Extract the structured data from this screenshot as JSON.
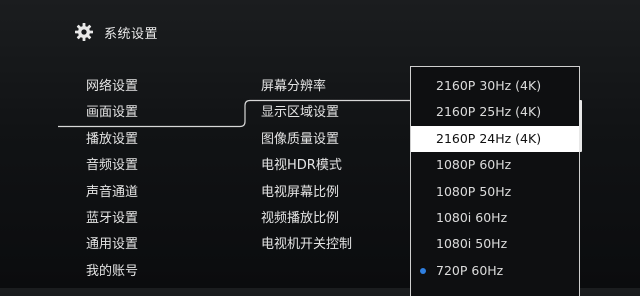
{
  "header": {
    "title": "系统设置",
    "icon": "gear-icon"
  },
  "menu": {
    "items": [
      "网络设置",
      "画面设置",
      "播放设置",
      "音频设置",
      "声音通道",
      "蓝牙设置",
      "通用设置",
      "我的账号"
    ],
    "active": "画面设置"
  },
  "submenu": {
    "items": [
      "屏幕分辨率",
      "显示区域设置",
      "图像质量设置",
      "电视HDR模式",
      "电视屏幕比例",
      "视频播放比例",
      "电视机开关控制"
    ]
  },
  "resolution": {
    "options": [
      "2160P 30Hz (4K)",
      "2160P 25Hz (4K)",
      "2160P 24Hz (4K)",
      "1080P 60Hz",
      "1080P 50Hz",
      "1080i 60Hz",
      "1080i 50Hz",
      "720P 60Hz"
    ],
    "focused": "2160P 24Hz (4K)",
    "current": "720P 60Hz"
  },
  "colors": {
    "focus_bg": "#ffffff",
    "current_dot": "#2f7fe0",
    "outline": "#cfcfcf"
  }
}
